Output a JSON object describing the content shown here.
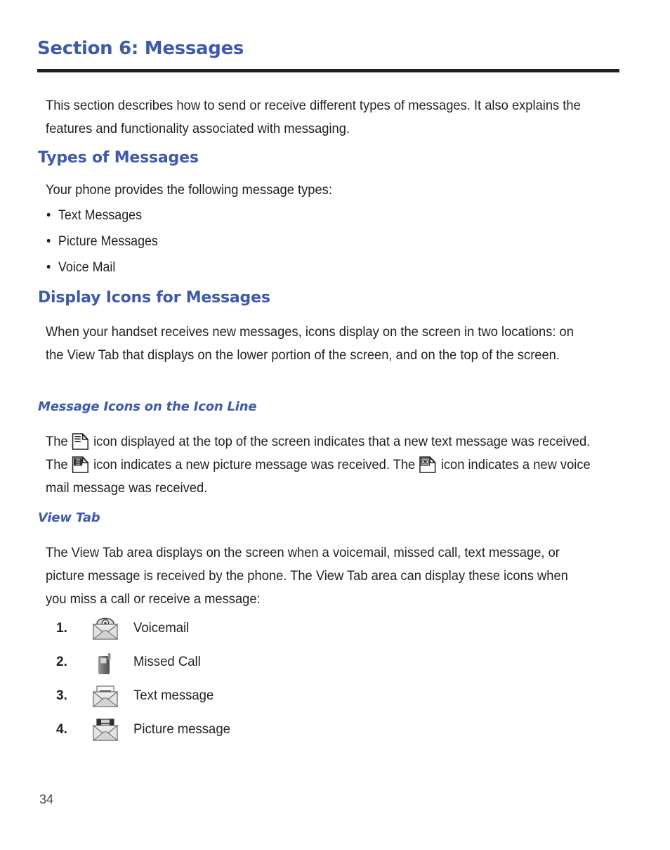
{
  "document": {
    "section_title": "Section 6: Messages",
    "page_number": "34"
  },
  "intro": {
    "paragraph": "This section describes how to send or receive different types of messages. It also explains the features and functionality associated with messaging."
  },
  "types_of_messages": {
    "heading": "Types of Messages",
    "intro": "Your phone provides the following message types:",
    "bullet_marker": "•",
    "items": [
      "Text Messages",
      "Picture Messages",
      "Voice Mail"
    ]
  },
  "display_icons": {
    "heading": "Display Icons for Messages",
    "paragraph": "When your handset receives new messages, icons display on the screen in two locations: on the View Tab that displays on the lower portion of the screen, and on the top of the screen."
  },
  "message_icons_line": {
    "heading": "Message Icons on the Icon Line",
    "part_1": "The ",
    "part_2": " icon displayed at the top of the screen indicates that a new text message was received. The ",
    "part_3": " icon indicates a new picture message was received. The ",
    "part_4": " icon indicates a new voice mail message was received.",
    "icons": [
      "text-message-line-icon",
      "picture-message-line-icon",
      "voice-mail-line-icon"
    ]
  },
  "view_tab": {
    "heading": "View Tab",
    "paragraph": "The View Tab area displays on the screen when a voicemail, missed call, text message, or picture message is received by the phone. The View Tab area can display these icons when you miss a call or receive a message:",
    "list": [
      {
        "number": "1.",
        "label": "Voicemail",
        "icon": "voicemail-envelope-icon"
      },
      {
        "number": "2.",
        "label": "Missed Call",
        "icon": "missed-call-handset-icon"
      },
      {
        "number": "3.",
        "label": "Text message",
        "icon": "text-message-envelope-icon"
      },
      {
        "number": "4.",
        "label": "Picture message",
        "icon": "picture-message-envelope-icon"
      }
    ]
  },
  "colors": {
    "heading_blue": "#3f5aa9",
    "body_text": "#231f20",
    "rule": "#231f20",
    "page_background": "#ffffff"
  }
}
